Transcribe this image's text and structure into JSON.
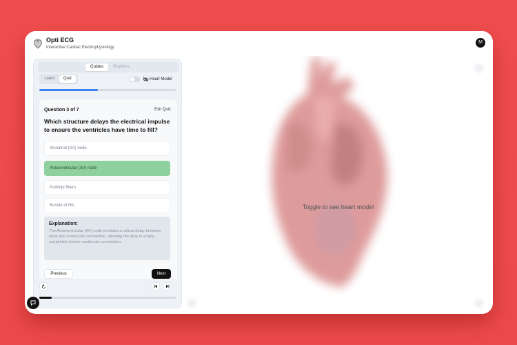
{
  "app": {
    "title": "Opti ECG",
    "subtitle": "Interactive Cardiac Electrophysiology",
    "avatar_initial": "M"
  },
  "panel": {
    "top_tabs": [
      {
        "label": "Guides",
        "active": true
      },
      {
        "label": "Rhythms",
        "active": false
      }
    ],
    "mode_tabs": [
      {
        "label": "Learn",
        "active": false
      },
      {
        "label": "Quiz",
        "active": true
      }
    ],
    "heart_model_toggle": {
      "label": "Heart Model",
      "on": false
    },
    "quiz_progress_fraction": 0.43
  },
  "quiz": {
    "counter": "Question 3 of 7",
    "exit_label": "Exit Quiz",
    "question": "Which structure delays the electrical impulse to ensure the ventricles have time to fill?",
    "options": [
      {
        "label": "Sinoatrial (SA) node",
        "correct": false
      },
      {
        "label": "Atrioventricular (AV) node",
        "correct": true
      },
      {
        "label": "Purkinje fibers",
        "correct": false
      },
      {
        "label": "Bundle of His",
        "correct": false
      }
    ],
    "explanation_title": "Explanation:",
    "explanation_body": "The Atrioventricular (AV) node provides a critical delay between atrial and ventricular contraction, allowing the atria to empty completely before ventricular contraction.",
    "previous_label": "Previous",
    "next_label": "Next"
  },
  "player": {
    "timeline_fraction": 0.09,
    "icons": [
      "restart-icon",
      "skip-back-icon",
      "skip-forward-icon"
    ]
  },
  "viewer": {
    "message": "Toggle to see heart model"
  },
  "colors": {
    "background": "#ef4d4d",
    "accent": "#3b82f6",
    "correct": "#8fd19e",
    "dark": "#111111"
  }
}
